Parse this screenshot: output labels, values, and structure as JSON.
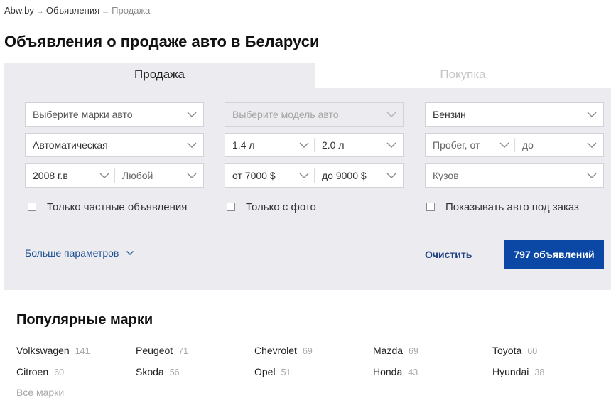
{
  "breadcrumb": {
    "items": [
      "Abw.by",
      "Объявления",
      "Продажа"
    ],
    "separator": "→"
  },
  "page": {
    "title": "Объявления о продаже авто в Беларуси"
  },
  "tabs": [
    {
      "label": "Продажа",
      "active": true
    },
    {
      "label": "Покупка",
      "active": false
    }
  ],
  "filters": {
    "brand": {
      "placeholder": "Выберите марки авто"
    },
    "model": {
      "placeholder": "Выберите модель авто",
      "disabled": true
    },
    "fuel": {
      "value": "Бензин"
    },
    "transmission": {
      "value": "Автоматическая"
    },
    "engine_from": {
      "value": "1.4 л"
    },
    "engine_to": {
      "value": "2.0 л"
    },
    "mileage_from": {
      "placeholder": "Пробег, от"
    },
    "mileage_to": {
      "placeholder": "до"
    },
    "year_from": {
      "value": "2008 г.в"
    },
    "year_to": {
      "placeholder": "Любой"
    },
    "price_from": {
      "value": "от 7000 $"
    },
    "price_to": {
      "value": "до 9000 $"
    },
    "body": {
      "placeholder": "Кузов"
    }
  },
  "checkboxes": {
    "private_only": {
      "label": "Только частные объявления",
      "checked": false
    },
    "with_photo": {
      "label": "Только с фото",
      "checked": false
    },
    "show_on_order": {
      "label": "Показывать авто под заказ",
      "checked": false
    }
  },
  "actions": {
    "more_params": "Больше параметров",
    "clear": "Очистить",
    "search": "797 объявлений"
  },
  "popular": {
    "title": "Популярные марки",
    "brands": [
      {
        "name": "Volkswagen",
        "count": "141"
      },
      {
        "name": "Peugeot",
        "count": "71"
      },
      {
        "name": "Chevrolet",
        "count": "69"
      },
      {
        "name": "Mazda",
        "count": "69"
      },
      {
        "name": "Toyota",
        "count": "60"
      },
      {
        "name": "Citroen",
        "count": "60"
      },
      {
        "name": "Skoda",
        "count": "56"
      },
      {
        "name": "Opel",
        "count": "51"
      },
      {
        "name": "Honda",
        "count": "43"
      },
      {
        "name": "Hyundai",
        "count": "38"
      }
    ],
    "all_link": "Все марки"
  },
  "colors": {
    "accent": "#0b48a6",
    "link": "#1d4f91",
    "panel_bg": "#ebebf0"
  }
}
